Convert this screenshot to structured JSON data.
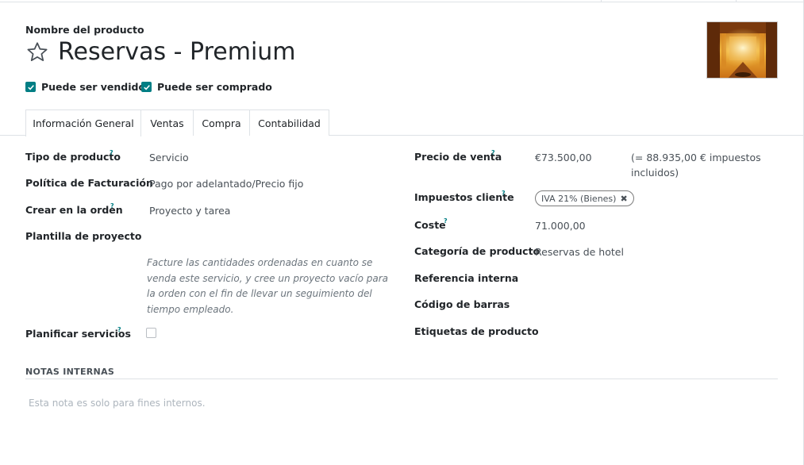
{
  "header": {
    "name_label": "Nombre del producto",
    "title": "Reservas - Premium",
    "favorite_icon": "star-outline-icon",
    "image_alt": "product-image-hotel-lobby"
  },
  "flags": {
    "can_be_sold": {
      "label": "Puede ser vendido",
      "checked": true
    },
    "can_be_purchased": {
      "label": "Puede ser comprado",
      "checked": true
    }
  },
  "tabs": [
    {
      "label": "Información General",
      "active": true
    },
    {
      "label": "Ventas",
      "active": false
    },
    {
      "label": "Compra",
      "active": false
    },
    {
      "label": "Contabilidad",
      "active": false
    }
  ],
  "left": {
    "product_type": {
      "label": "Tipo de producto",
      "help": "?",
      "value": "Servicio"
    },
    "invoicing_policy": {
      "label": "Política de Facturación",
      "value": "Pago por adelantado/Precio fijo"
    },
    "create_on_order": {
      "label": "Crear en la orden",
      "help": "?",
      "value": "Proyecto y tarea"
    },
    "project_template": {
      "label": "Plantilla de proyecto",
      "value": ""
    },
    "invoice_note": "Facture las cantidades ordenadas en cuanto se venda este servicio, y cree un proyecto vacío para la orden con el fin de llevar un seguimiento del tiempo empleado.",
    "plan_services": {
      "label": "Planificar servicios",
      "help": "?",
      "checked": false
    }
  },
  "right": {
    "sale_price": {
      "label": "Precio de venta",
      "help": "?",
      "value": "€73.500,00",
      "taxes_included": "(= 88.935,00 € impuestos incluidos)"
    },
    "customer_taxes": {
      "label": "Impuestos cliente",
      "help": "?",
      "tag": "IVA 21% (Bienes)",
      "remove_icon": "close-x-icon"
    },
    "cost": {
      "label": "Coste",
      "help": "?",
      "value": "71.000,00"
    },
    "category": {
      "label": "Categoría de producto",
      "value": "Reservas de hotel"
    },
    "internal_ref": {
      "label": "Referencia interna",
      "value": ""
    },
    "barcode": {
      "label": "Código de barras",
      "value": ""
    },
    "tags": {
      "label": "Etiquetas de producto",
      "value": ""
    }
  },
  "notes": {
    "title": "NOTAS INTERNAS",
    "placeholder": "Esta nota es solo para fines internos."
  },
  "colors": {
    "accent": "#017e84",
    "text": "#212529",
    "muted": "#6c757d",
    "border": "#dee2e6"
  }
}
